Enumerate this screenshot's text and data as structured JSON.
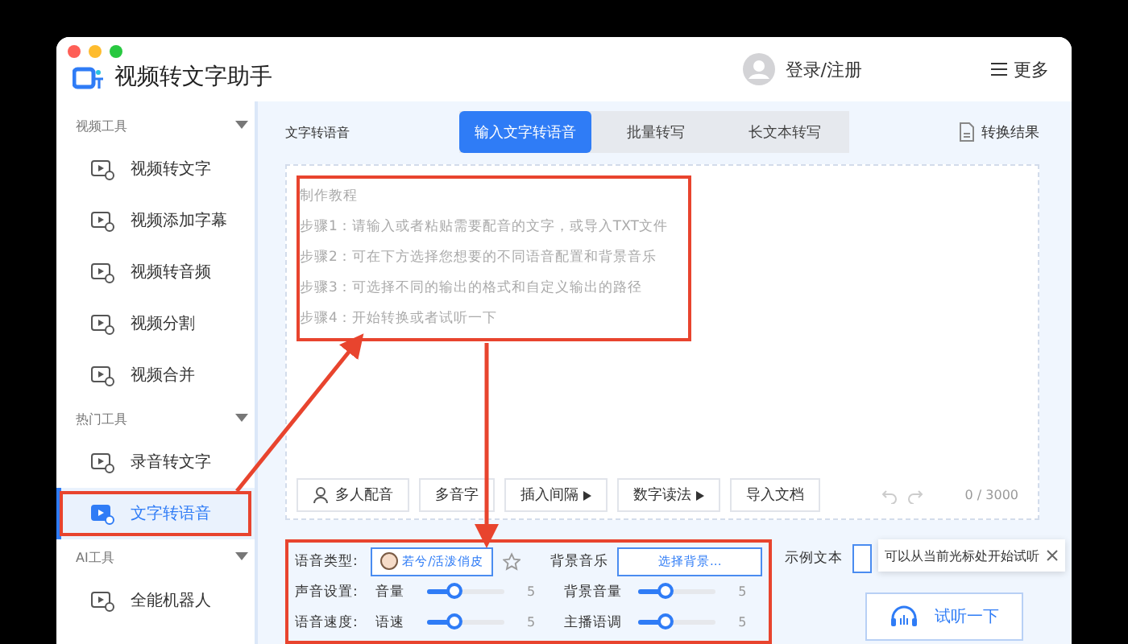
{
  "window": {
    "title": "视频转文字助手",
    "login": "登录/注册",
    "more": "更多"
  },
  "sidebar": {
    "sections": [
      {
        "title": "视频工具",
        "expanded": true,
        "items": [
          {
            "label": "视频转文字",
            "selected": false,
            "annotated": false
          },
          {
            "label": "视频添加字幕",
            "selected": false,
            "annotated": false
          },
          {
            "label": "视频转音频",
            "selected": false,
            "annotated": false
          },
          {
            "label": "视频分割",
            "selected": false,
            "annotated": false
          },
          {
            "label": "视频合并",
            "selected": false,
            "annotated": false
          }
        ]
      },
      {
        "title": "热门工具",
        "expanded": true,
        "items": [
          {
            "label": "录音转文字",
            "selected": false,
            "annotated": false
          },
          {
            "label": "文字转语音",
            "selected": true,
            "annotated": true
          }
        ]
      },
      {
        "title": "AI工具",
        "expanded": true,
        "items": [
          {
            "label": "全能机器人",
            "selected": false,
            "annotated": false
          }
        ]
      }
    ]
  },
  "header": {
    "page_title": "文字转语音",
    "tabs": [
      {
        "label": "输入文字转语音",
        "selected": true
      },
      {
        "label": "批量转写",
        "selected": false
      },
      {
        "label": "长文本转写",
        "selected": false
      }
    ],
    "result_link": "转换结果"
  },
  "editor": {
    "annotated": true,
    "placeholder_lines": [
      "制作教程",
      "步骤1：请输入或者粘贴需要配音的文字，或导入TXT文件",
      "步骤2：可在下方选择您想要的不同语音配置和背景音乐",
      "步骤3：可选择不同的输出的格式和自定义输出的路径",
      "步骤4：开始转换或者试听一下"
    ],
    "toolbar": [
      {
        "label": "多人配音",
        "kind": "icon"
      },
      {
        "label": "多音字",
        "kind": "plain"
      },
      {
        "label": "插入间隔",
        "kind": "menu"
      },
      {
        "label": "数字读法",
        "kind": "menu"
      },
      {
        "label": "导入文档",
        "kind": "plain"
      }
    ],
    "counter": "0 / 3000"
  },
  "settings": {
    "annotated": true,
    "voice_label": "语音类型:",
    "voice": "若兮/活泼俏皮",
    "favorite": false,
    "music_label": "背景音乐",
    "music_button": "选择背景...",
    "rows": [
      {
        "label": "声音设置:",
        "sliders": [
          {
            "name": "音量",
            "level": 0.35,
            "reading": "5"
          },
          {
            "name": "背景音量",
            "level": 0.35,
            "reading": "5"
          }
        ]
      },
      {
        "label": "语音速度:",
        "sliders": [
          {
            "name": "语速",
            "level": 0.35,
            "reading": "5"
          },
          {
            "name": "主播语调",
            "level": 0.35,
            "reading": "5"
          }
        ]
      }
    ]
  },
  "preview": {
    "sample_label": "示例文本",
    "tooltip": "可以从当前光标处开始试听",
    "listen_button": "试听一下"
  }
}
